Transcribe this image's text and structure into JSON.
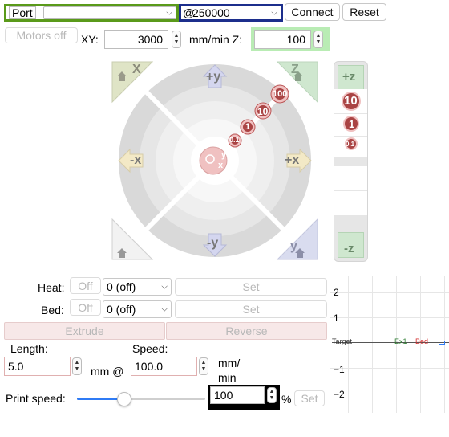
{
  "connection": {
    "port_label": "Port",
    "port_value": "",
    "baud_prefix": "@",
    "baud_value": "250000",
    "connect_label": "Connect",
    "reset_label": "Reset"
  },
  "motion": {
    "motors_off_label": "Motors off",
    "xy_label": "XY:",
    "xy_value": "3000",
    "unit_label": "mm/min Z:",
    "z_value": "100"
  },
  "jog": {
    "home_x": "X",
    "home_z": "Z",
    "plus_y": "+y",
    "minus_y": "-y",
    "plus_x": "+x",
    "minus_x": "-x",
    "step_100": "100",
    "step_10": "10",
    "step_1": "1",
    "step_01": "0.1",
    "center_x": "x",
    "center_y": "y",
    "home_y": "y",
    "z_plus": "+z",
    "z_minus": "-z",
    "z_10": "10",
    "z_1": "1",
    "z_01": "0.1"
  },
  "temps": {
    "heat_label": "Heat:",
    "heat_off": "Off",
    "heat_value": "0 (off)",
    "heat_set": "Set",
    "bed_label": "Bed:",
    "bed_off": "Off",
    "bed_value": "0 (off)",
    "bed_set": "Set"
  },
  "extrusion": {
    "extrude_label": "Extrude",
    "reverse_label": "Reverse",
    "length_label": "Length:",
    "length_value": "5.0",
    "mm_at": "mm @",
    "speed_label": "Speed:",
    "speed_value": "100.0",
    "speed_unit_1": "mm/",
    "speed_unit_2": "min"
  },
  "print_speed": {
    "label": "Print speed:",
    "value": "100",
    "percent": "%",
    "set_label": "Set",
    "slider_fraction": 0.35
  },
  "graph": {
    "yticks": [
      "2",
      "1",
      "−1",
      "−2"
    ],
    "legend_target": "Target",
    "legend_ex1": "Ex1",
    "legend_bed": "Bed",
    "ex1_color": "#2e7d32",
    "bed_color": "#d32f2f"
  },
  "colors": {
    "port_border": "#5a9a1a",
    "baud_border": "#1c2e8c",
    "z_field_highlight": "#b9ecb4",
    "slider_blue": "#2f7bf5",
    "extrude_bg": "#f7e8e8"
  }
}
